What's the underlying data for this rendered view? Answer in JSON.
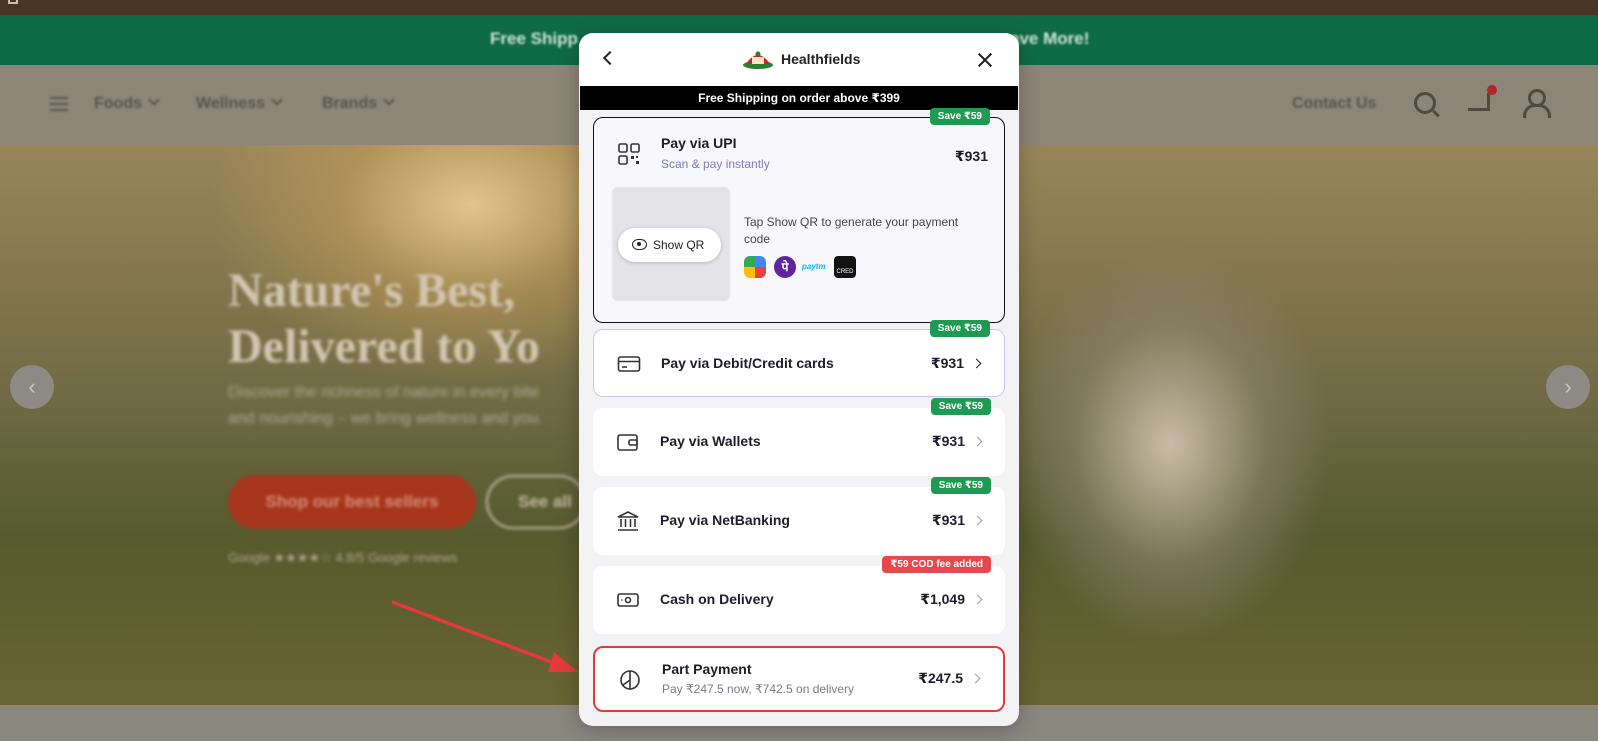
{
  "background": {
    "promo_left": "Free Shipp",
    "promo_right": "ave More!",
    "nav": {
      "items": [
        "Foods",
        "Wellness",
        "Brands"
      ],
      "contact": "Contact Us"
    },
    "hero": {
      "title_line1": "Nature's Best,",
      "title_line2": "Delivered to Yo",
      "description": "Discover the richness of nature in every bite and nourishing – we bring wellness and you.",
      "primary_button": "Shop our best sellers",
      "secondary_button": "See all",
      "rating_text": "Google ★★★★☆ 4.8/5 Google reviews"
    }
  },
  "modal": {
    "brand": "Healthfields",
    "shipping_banner": "Free Shipping on order above ₹399",
    "upi": {
      "title": "Pay via UPI",
      "subtitle": "Scan & pay instantly",
      "amount": "₹931",
      "badge": "Save ₹59",
      "show_qr_label": "Show QR",
      "qr_hint": "Tap Show QR to generate your payment code",
      "apps": [
        "gpay-icon",
        "phonepe-icon",
        "paytm-icon",
        "cred-icon"
      ],
      "phonepe_glyph": "पे",
      "paytm_text": "paytm",
      "cred_text": "CRED"
    },
    "methods": [
      {
        "title": "Pay via Debit/Credit cards",
        "amount": "₹931",
        "badge": "Save ₹59"
      },
      {
        "title": "Pay via Wallets",
        "amount": "₹931",
        "badge": "Save ₹59"
      },
      {
        "title": "Pay via NetBanking",
        "amount": "₹931",
        "badge": "Save ₹59"
      },
      {
        "title": "Cash on Delivery",
        "amount": "₹1,049",
        "badge": "₹59 COD fee added"
      }
    ],
    "part_payment": {
      "title": "Part Payment",
      "subtitle": "Pay ₹247.5 now, ₹742.5 on delivery",
      "amount": "₹247.5"
    }
  },
  "colors": {
    "promo_green": "#0f6b45",
    "save_badge": "#1f9a52",
    "cod_badge": "#e5484d",
    "highlight_red": "#e33b3b",
    "upi_subtitle": "#7b7bc0"
  }
}
